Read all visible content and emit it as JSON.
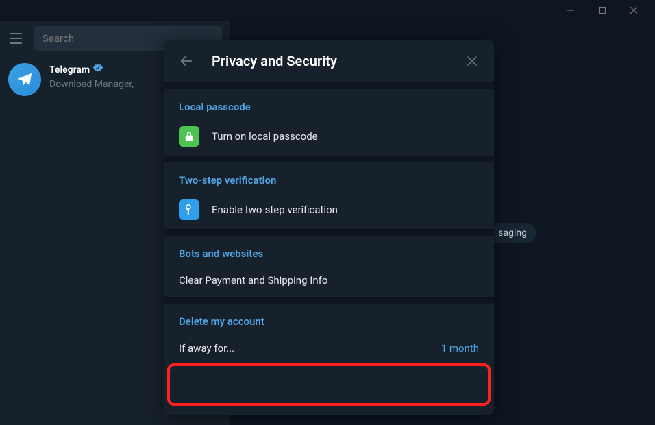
{
  "search": {
    "placeholder": "Search"
  },
  "chat": {
    "name": "Telegram",
    "preview": "Download Manager,"
  },
  "background_badge": "saging",
  "dialog": {
    "title": "Privacy and Security",
    "sections": {
      "local_passcode": {
        "title": "Local passcode",
        "action": "Turn on local passcode"
      },
      "two_step": {
        "title": "Two-step verification",
        "action": "Enable two-step verification"
      },
      "bots": {
        "title": "Bots and websites",
        "action": "Clear Payment and Shipping Info"
      },
      "delete": {
        "title": "Delete my account",
        "label": "If away for...",
        "value": "1 month"
      }
    }
  }
}
